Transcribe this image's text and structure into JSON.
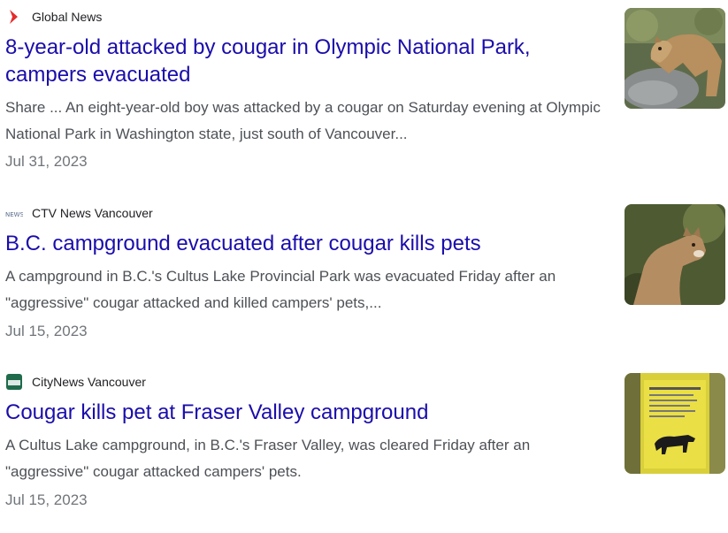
{
  "articles": [
    {
      "source": "Global News",
      "source_icon": "global-news-logo-icon",
      "title": "8-year-old attacked by cougar in Olympic National Park, campers evacuated",
      "snippet": "Share ... An eight-year-old boy was attacked by a cougar on Saturday evening at Olympic National Park in Washington state, just south of Vancouver...",
      "date": "Jul 31, 2023",
      "thumbnail": "cougar-on-rock-thumbnail"
    },
    {
      "source": "CTV News Vancouver",
      "source_icon": "ctv-news-logo-icon",
      "title": "B.C. campground evacuated after cougar kills pets",
      "snippet": "A campground in B.C.'s Cultus Lake Provincial Park was evacuated Friday after an \"aggressive\" cougar attacked and killed campers' pets,...",
      "date": "Jul 15, 2023",
      "thumbnail": "cougar-portrait-thumbnail"
    },
    {
      "source": "CityNews Vancouver",
      "source_icon": "citynews-logo-icon",
      "title": "Cougar kills pet at Fraser Valley campground",
      "snippet": "A Cultus Lake campground, in B.C.'s Fraser Valley, was cleared Friday after an \"aggressive\" cougar attacked campers' pets.",
      "date": "Jul 15, 2023",
      "thumbnail": "cougar-warning-sign-thumbnail"
    }
  ],
  "colors": {
    "headline": "#1a0dab",
    "snippet": "#4d5156",
    "date": "#70757a",
    "source": "#202124",
    "global_news_red": "#e52b2b",
    "citynews_green": "#1f6b4b",
    "sign_yellow": "#e8dc3c"
  }
}
